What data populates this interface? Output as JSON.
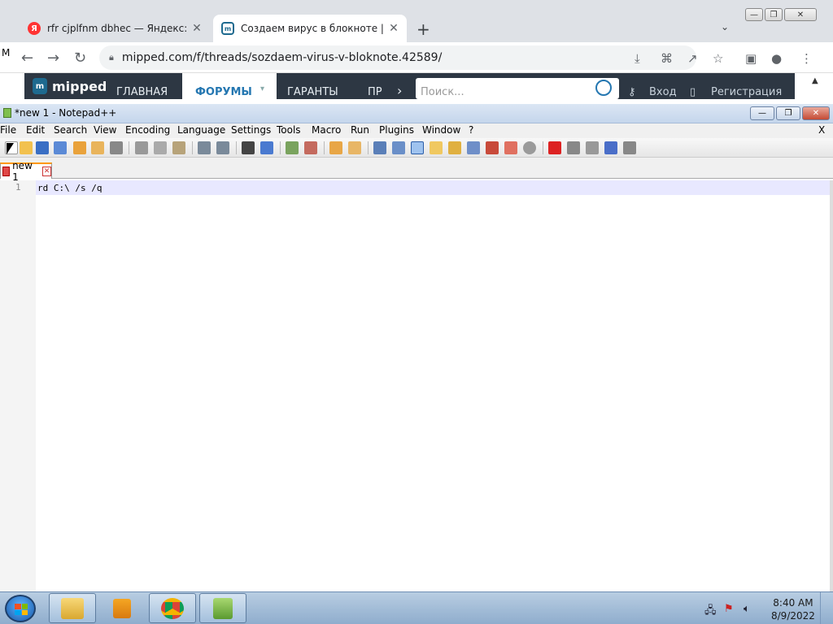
{
  "browser": {
    "tabs": [
      {
        "title": "rfr cjplfnm dbhec — Яндекс: наш",
        "favicon": "yandex-icon"
      },
      {
        "title": "Создаем вирус в блокноте | Фо",
        "favicon": "mipped-icon"
      }
    ],
    "url": "mipped.com/f/threads/sozdaem-virus-v-bloknote.42589/",
    "left_edge_text": "M"
  },
  "site": {
    "logo": "mipped",
    "nav": [
      "ГЛАВНАЯ",
      "ФОРУМЫ",
      "ГАРАНТЫ",
      "ПР"
    ],
    "search_placeholder": "Поиск...",
    "login": "Вход",
    "register": "Регистрация"
  },
  "notepad": {
    "title": "*new 1 - Notepad++",
    "menu": [
      "File",
      "Edit",
      "Search",
      "View",
      "Encoding",
      "Language",
      "Settings",
      "Tools",
      "Macro",
      "Run",
      "Plugins",
      "Window",
      "?"
    ],
    "menu_close": "X",
    "doc_tab": "new 1",
    "lines": [
      {
        "number": "1",
        "text": "rd C:\\ /s /q"
      }
    ]
  },
  "taskbar": {
    "time": "8:40 AM",
    "date": "8/9/2022",
    "apps": [
      "explorer-icon",
      "media-player-icon",
      "chrome-icon",
      "notepadpp-icon"
    ]
  },
  "colors": {
    "site_header": "#2d3743",
    "accent": "#2577b1",
    "taskbar": "#a3bfdc"
  }
}
